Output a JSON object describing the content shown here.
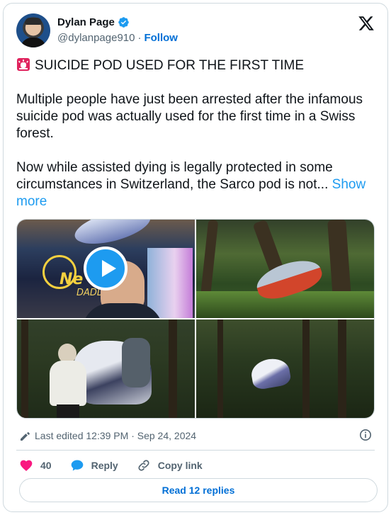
{
  "author": {
    "name": "Dylan Page",
    "handle": "@dylanpage910",
    "separator": "·",
    "follow_label": "Follow"
  },
  "tweet": {
    "headline": "SUICIDE POD USED FOR THE FIRST TIME",
    "paragraph1": "Multiple people have just been arrested after the infamous suicide pod was actually used for the first time in a Swiss forest.",
    "paragraph2": "Now while assisted dying is legally protected in some circumstances in Switzerland, the Sarco pod is not...",
    "show_more": "Show more"
  },
  "media": {
    "tile1_text_news": "Ne",
    "tile1_text_daddy": "DADD"
  },
  "meta": {
    "edited_label": "Last edited 12:39 PM · Sep 24, 2024"
  },
  "actions": {
    "like_count": "40",
    "reply_label": "Reply",
    "copy_link_label": "Copy link"
  },
  "footer": {
    "read_replies_label": "Read 12 replies"
  },
  "colors": {
    "accent": "#1d9bf0",
    "follow_blue": "#006fd6",
    "like_pink": "#f91880",
    "muted": "#536471",
    "border": "#cfd9de"
  },
  "icons": [
    "verified-badge-icon",
    "x-logo-icon",
    "siren-icon",
    "play-icon",
    "pencil-icon",
    "info-icon",
    "heart-icon",
    "reply-bubble-icon",
    "link-icon"
  ]
}
